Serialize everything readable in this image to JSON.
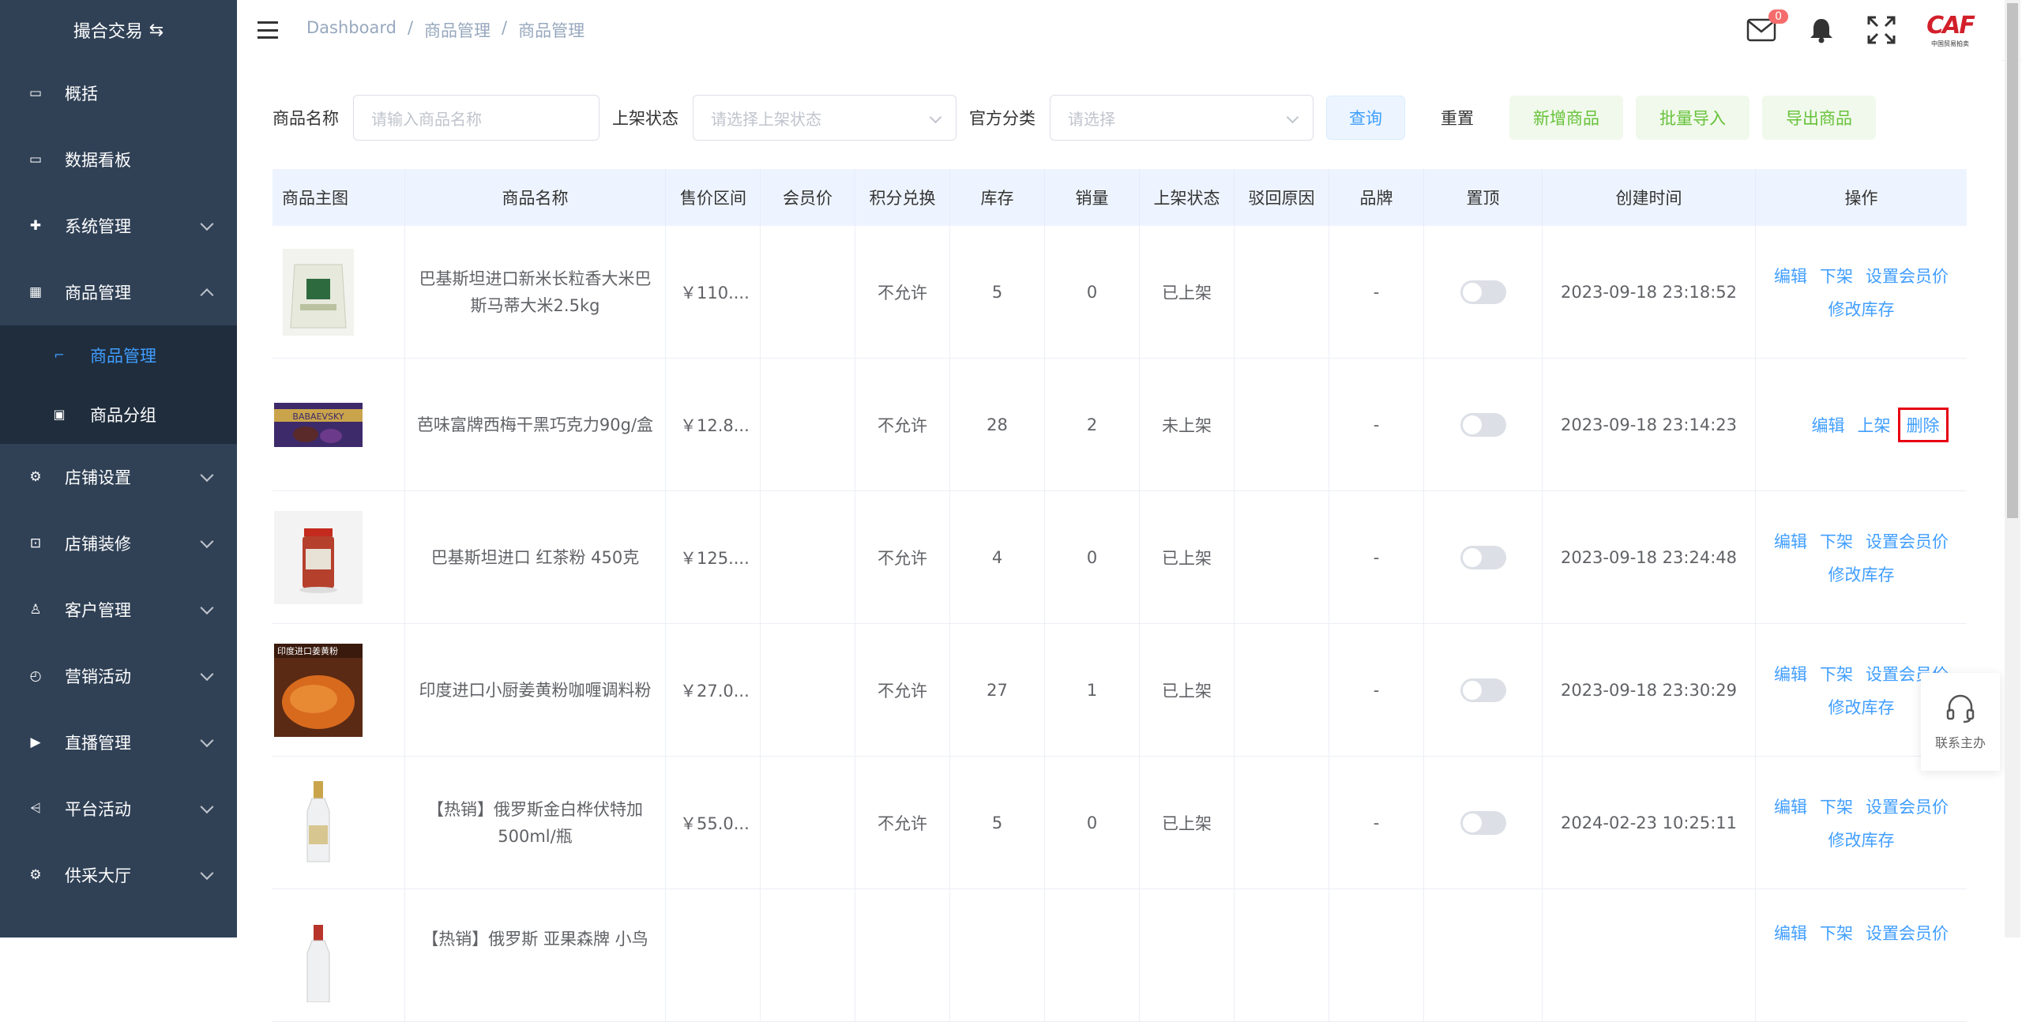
{
  "sidebar": {
    "logo": "撮合交易",
    "items": [
      {
        "label": "概括"
      },
      {
        "label": "数据看板"
      },
      {
        "label": "系统管理"
      },
      {
        "label": "商品管理"
      },
      {
        "label": "店铺设置"
      },
      {
        "label": "店铺装修"
      },
      {
        "label": "客户管理"
      },
      {
        "label": "营销活动"
      },
      {
        "label": "直播管理"
      },
      {
        "label": "平台活动"
      },
      {
        "label": "供采大厅"
      }
    ],
    "sub_items": [
      {
        "label": "商品管理"
      },
      {
        "label": "商品分组"
      }
    ]
  },
  "header": {
    "breadcrumb": [
      "Dashboard",
      "商品管理",
      "商品管理"
    ],
    "mail_badge": "0"
  },
  "filters": {
    "name_label": "商品名称",
    "name_placeholder": "请输入商品名称",
    "status_label": "上架状态",
    "status_placeholder": "请选择上架状态",
    "category_label": "官方分类",
    "category_placeholder": "请选择",
    "query": "查询",
    "reset": "重置",
    "add": "新增商品",
    "import": "批量导入",
    "export": "导出商品"
  },
  "table": {
    "headers": [
      "商品主图",
      "商品名称",
      "售价区间",
      "会员价",
      "积分兑换",
      "库存",
      "销量",
      "上架状态",
      "驳回原因",
      "品牌",
      "置顶",
      "创建时间",
      "操作"
    ],
    "rows": [
      {
        "name": "巴基斯坦进口新米长粒香大米巴斯马蒂大米2.5kg",
        "price": "￥110....",
        "member": "",
        "points": "不允许",
        "stock": "5",
        "sales": "0",
        "status": "已上架",
        "reason": "",
        "brand": "-",
        "created": "2023-09-18 23:18:52",
        "ops": [
          "编辑",
          "下架",
          "设置会员价",
          "修改库存"
        ]
      },
      {
        "name": "芭味富牌西梅干黑巧克力90g/盒",
        "price": "￥12.8...",
        "member": "",
        "points": "不允许",
        "stock": "28",
        "sales": "2",
        "status": "未上架",
        "reason": "",
        "brand": "-",
        "created": "2023-09-18 23:14:23",
        "ops": [
          "编辑",
          "上架",
          "删除"
        ]
      },
      {
        "name": "巴基斯坦进口 红茶粉 450克",
        "price": "￥125....",
        "member": "",
        "points": "不允许",
        "stock": "4",
        "sales": "0",
        "status": "已上架",
        "reason": "",
        "brand": "-",
        "created": "2023-09-18 23:24:48",
        "ops": [
          "编辑",
          "下架",
          "设置会员价",
          "修改库存"
        ]
      },
      {
        "name": "印度进口小厨姜黄粉咖喱调料粉",
        "price": "￥27.0...",
        "member": "",
        "points": "不允许",
        "stock": "27",
        "sales": "1",
        "status": "已上架",
        "reason": "",
        "brand": "-",
        "created": "2023-09-18 23:30:29",
        "ops": [
          "编辑",
          "下架",
          "设置会员价",
          "修改库存"
        ]
      },
      {
        "name": "【热销】俄罗斯金白桦伏特加 500ml/瓶",
        "price": "￥55.0...",
        "member": "",
        "points": "不允许",
        "stock": "5",
        "sales": "0",
        "status": "已上架",
        "reason": "",
        "brand": "-",
        "created": "2024-02-23 10:25:11",
        "ops": [
          "编辑",
          "下架",
          "设置会员价",
          "修改库存"
        ]
      },
      {
        "name": "【热销】俄罗斯 亚果森牌 小鸟",
        "price": "",
        "member": "",
        "points": "",
        "stock": "",
        "sales": "",
        "status": "",
        "reason": "",
        "brand": "",
        "created": "",
        "ops": [
          "编辑",
          "下架",
          "设置会员价"
        ]
      }
    ]
  },
  "contact": "联系主办"
}
